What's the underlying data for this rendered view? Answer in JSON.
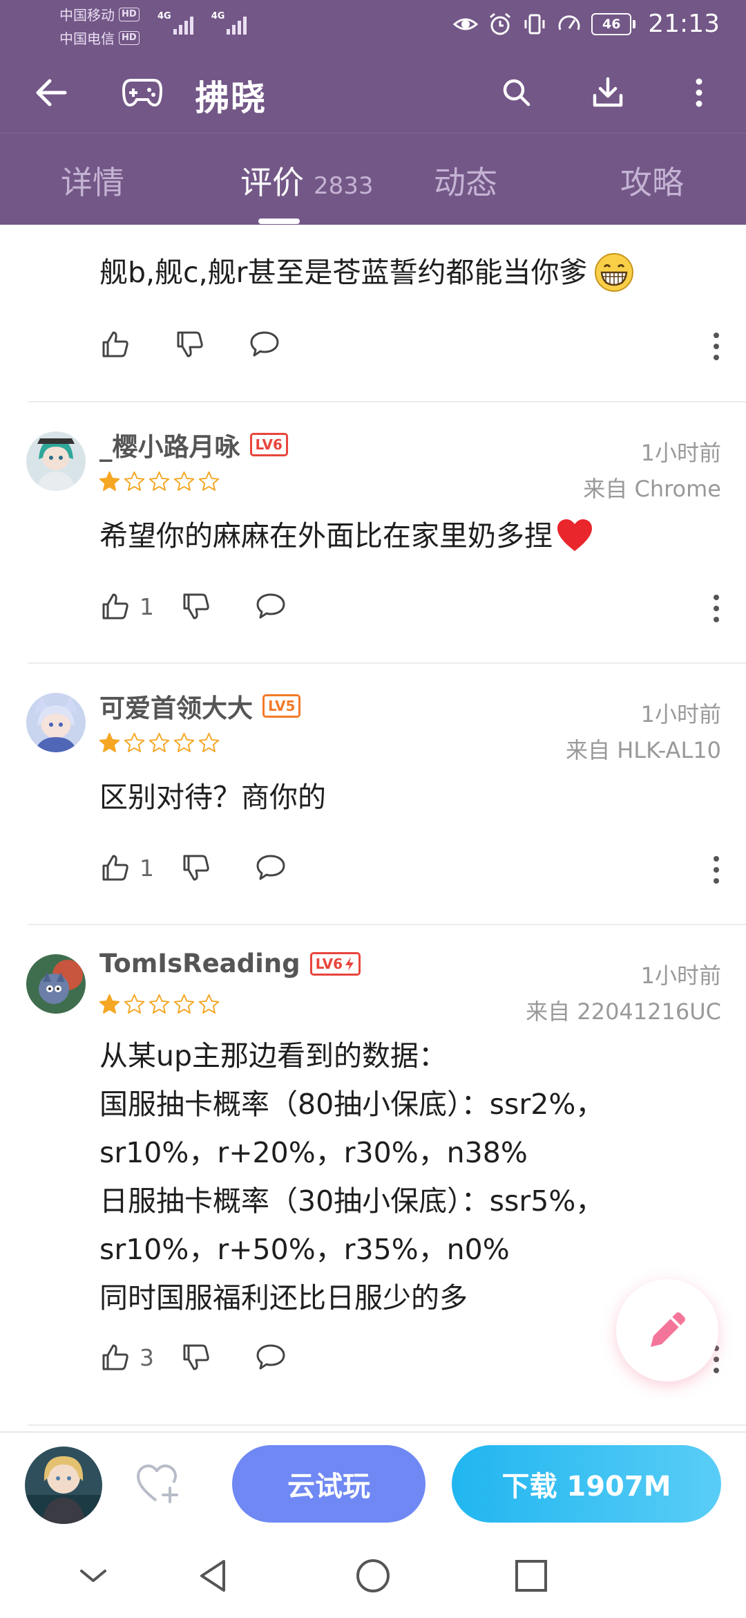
{
  "status_bar": {
    "carrier1": "中国移动",
    "carrier2": "中国电信",
    "hd": "HD",
    "net1": "4G",
    "net2": "4G",
    "battery": "46",
    "time": "21:13"
  },
  "app_bar": {
    "title": "拂晓"
  },
  "tabs": [
    {
      "label": "详情"
    },
    {
      "label": "评价",
      "count": "2833"
    },
    {
      "label": "动态"
    },
    {
      "label": "攻略"
    }
  ],
  "reviews": [
    {
      "text": "舰b,舰c,舰r甚至是苍蓝誓约都能当你爹",
      "likes": ""
    },
    {
      "username": "_樱小路月咏",
      "level": "LV6",
      "rating": 1,
      "time": "1小时前",
      "source": "来自 Chrome",
      "text": "希望你的麻麻在外面比在家里奶多捏",
      "likes": "1"
    },
    {
      "username": "可爱首领大大",
      "level": "LV5",
      "rating": 1,
      "time": "1小时前",
      "source": "来自 HLK-AL10",
      "text": "区别对待？商你的",
      "likes": "1"
    },
    {
      "username": "TomIsReading",
      "level": "LV6",
      "rating": 1,
      "time": "1小时前",
      "source": "来自 22041216UC",
      "text": "从某up主那边看到的数据：\n国服抽卡概率（80抽小保底）：ssr2%，\nsr10%，r+20%，r30%，n38%\n日服抽卡概率（30抽小保底）：ssr5%，\nsr10%，r+50%，r35%，n0%\n同时国服福利还比日服少的多",
      "likes": "3"
    }
  ],
  "bottom_bar": {
    "try_label": "云试玩",
    "download_label": "下载 1907M"
  },
  "colors": {
    "header_bg": "#735787",
    "lv6": "#e8453c",
    "lv5": "#f47a2a",
    "star": "#f5a623",
    "try_btn": "#6f88f3",
    "download_btn": "#21b6f0",
    "fab_pencil": "#f4759a"
  },
  "icons": {
    "back": "arrow-left-icon",
    "game": "gamepad-icon",
    "search": "search-icon",
    "download": "download-icon",
    "menu": "more-vertical-icon",
    "like": "thumbs-up-icon",
    "dislike": "thumbs-down-icon",
    "comment": "comment-icon",
    "fab": "pencil-icon",
    "favorite": "heart-plus-icon"
  }
}
